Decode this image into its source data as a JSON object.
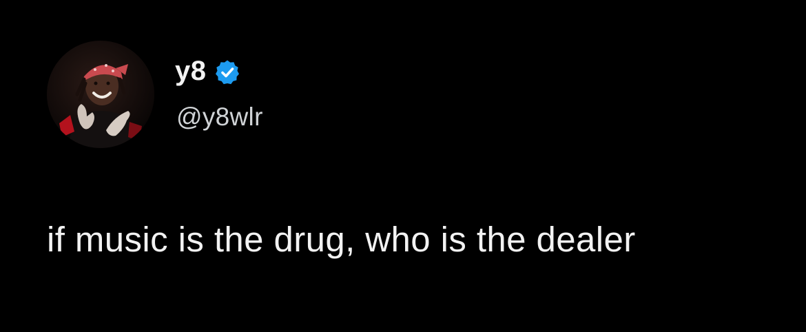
{
  "author": {
    "display_name": "y8",
    "handle": "@y8wlr",
    "verified": true,
    "verified_badge_icon": "verified-check-icon",
    "verified_badge_color": "#1d9bf0",
    "avatar_icon": "profile-photo"
  },
  "tweet": {
    "text": "if music is the drug, who is the dealer"
  },
  "colors": {
    "background": "#000000",
    "primary_text": "#f2f2f2",
    "secondary_text": "#d0d3d6"
  }
}
